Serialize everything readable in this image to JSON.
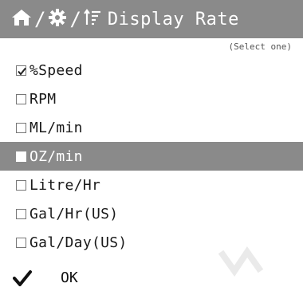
{
  "header": {
    "breadcrumb_sep1": "/",
    "breadcrumb_sep2": "/",
    "title": "Display Rate",
    "icons": [
      "home-icon",
      "gear-icon",
      "sort-filter-icon"
    ]
  },
  "hint": "(Select one)",
  "options": [
    {
      "label": "%Speed",
      "checked": true,
      "selected": false
    },
    {
      "label": "RPM",
      "checked": false,
      "selected": false
    },
    {
      "label": "ML/min",
      "checked": false,
      "selected": false
    },
    {
      "label": "OZ/min",
      "checked": false,
      "selected": true
    },
    {
      "label": "Litre/Hr",
      "checked": false,
      "selected": false
    },
    {
      "label": "Gal/Hr(US)",
      "checked": false,
      "selected": false
    },
    {
      "label": "Gal/Day(US)",
      "checked": false,
      "selected": false
    }
  ],
  "ok": {
    "label": "OK",
    "icon": "checkmark-icon"
  },
  "colors": {
    "header_bg": "#8a8a8a",
    "selected_bg": "#8a8a8a",
    "text": "#1a1a1a"
  }
}
